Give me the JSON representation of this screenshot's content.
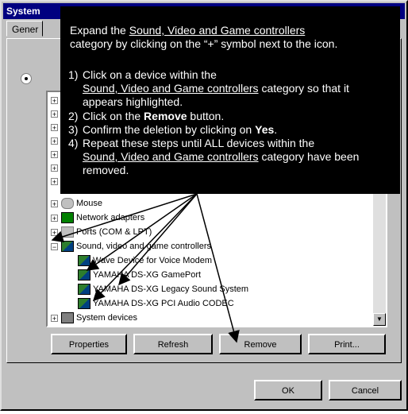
{
  "window": {
    "title": "System"
  },
  "tabs": [
    {
      "label": "Gener"
    }
  ],
  "tree": {
    "hidden_top_rows": 7,
    "items": [
      {
        "label": "Mouse",
        "icon": "mouse-icon",
        "expand": "+"
      },
      {
        "label": "Network adapters",
        "icon": "network-icon",
        "expand": "+"
      },
      {
        "label": "Ports (COM & LPT)",
        "icon": "port-icon",
        "expand": "+"
      },
      {
        "label": "Sound, video and game controllers",
        "icon": "sound-icon",
        "expand": "−"
      },
      {
        "label": "Wave Device for Voice Modem",
        "icon": "device-icon",
        "child": true
      },
      {
        "label": "YAMAHA DS-XG GamePort",
        "icon": "device-icon",
        "child": true
      },
      {
        "label": "YAMAHA DS-XG Legacy Sound System",
        "icon": "device-icon",
        "child": true
      },
      {
        "label": "YAMAHA DS-XG PCI Audio CODEC",
        "icon": "device-icon",
        "child": true
      },
      {
        "label": "System devices",
        "icon": "computer-icon",
        "expand": "+"
      }
    ]
  },
  "buttons": {
    "properties": "Properties",
    "refresh": "Refresh",
    "remove": "Remove",
    "print": "Print...",
    "ok": "OK",
    "cancel": "Cancel"
  },
  "callout": {
    "intro_1": "Expand the",
    "intro_link": "Sound, Video and Game controllers",
    "intro_2": "category by clicking on the “+” symbol next to the icon.",
    "step1_num": "1)",
    "step1_a": "Click on a device within the",
    "step1_link": "Sound, Video and Game controllers",
    "step1_b": "category so that it appears highlighted.",
    "step2_num": "2)",
    "step2_a": "Click on the",
    "step2_bold": "Remove",
    "step2_b": "button.",
    "step3_num": "3)",
    "step3_a": "Confirm the deletion by clicking on",
    "step3_bold": "Yes",
    "step3_b": ".",
    "step4_num": "4)",
    "step4_a": "Repeat these steps until  ALL  devices within the",
    "step4_link": "Sound, Video and Game controllers",
    "step4_b": "category have been removed."
  }
}
